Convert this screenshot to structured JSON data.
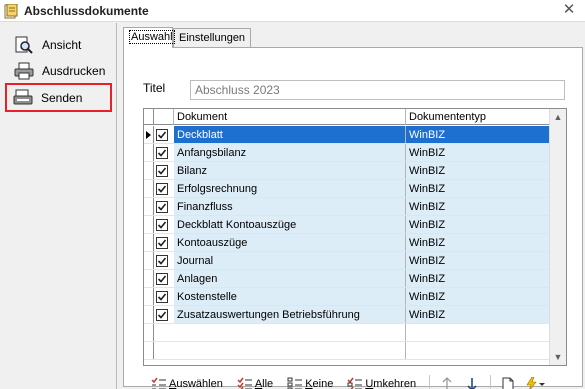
{
  "window": {
    "title": "Abschlussdokumente",
    "close_glyph": "✕"
  },
  "sidebar": {
    "items": [
      {
        "label": "Ansicht",
        "icon": "document-magnifier-icon"
      },
      {
        "label": "Ausdrucken",
        "icon": "printer-icon"
      },
      {
        "label": "Senden",
        "icon": "send-icon",
        "highlight_color": "#e8202a"
      }
    ]
  },
  "tabs": [
    {
      "label": "Auswahl",
      "active": true
    },
    {
      "label": "Einstellungen",
      "active": false
    }
  ],
  "form": {
    "titel_label": "Titel",
    "titel_value": "Abschluss 2023"
  },
  "grid": {
    "columns": [
      "Dokument",
      "Dokumententyp"
    ],
    "rows": [
      {
        "checked": true,
        "dokument": "Deckblatt",
        "typ": "WinBIZ",
        "selected": true
      },
      {
        "checked": true,
        "dokument": "Anfangsbilanz",
        "typ": "WinBIZ"
      },
      {
        "checked": true,
        "dokument": "Bilanz",
        "typ": "WinBIZ"
      },
      {
        "checked": true,
        "dokument": "Erfolgsrechnung",
        "typ": "WinBIZ"
      },
      {
        "checked": true,
        "dokument": "Finanzfluss",
        "typ": "WinBIZ"
      },
      {
        "checked": true,
        "dokument": "Deckblatt Kontoauszüge",
        "typ": "WinBIZ"
      },
      {
        "checked": true,
        "dokument": "Kontoauszüge",
        "typ": "WinBIZ"
      },
      {
        "checked": true,
        "dokument": "Journal",
        "typ": "WinBIZ"
      },
      {
        "checked": true,
        "dokument": "Anlagen",
        "typ": "WinBIZ"
      },
      {
        "checked": true,
        "dokument": "Kostenstelle",
        "typ": "WinBIZ"
      },
      {
        "checked": true,
        "dokument": "Zusatzauswertungen Betriebsführung",
        "typ": "WinBIZ"
      }
    ],
    "selected_color": "#1d6fd0",
    "row_color": "#dcedf8"
  },
  "toolbar": {
    "auswaehlen_mnemonic": "A",
    "auswaehlen_rest": "uswählen",
    "alle_mnemonic": "A",
    "alle_rest": "lle",
    "keine_mnemonic": "K",
    "keine_rest": "eine",
    "umkehren_mnemonic": "U",
    "umkehren_rest": "mkehren",
    "up_icon": "arrow-up-icon",
    "down_icon": "arrow-down-icon",
    "new_icon": "new-document-icon",
    "action_icon": "lightning-dropdown-icon"
  }
}
